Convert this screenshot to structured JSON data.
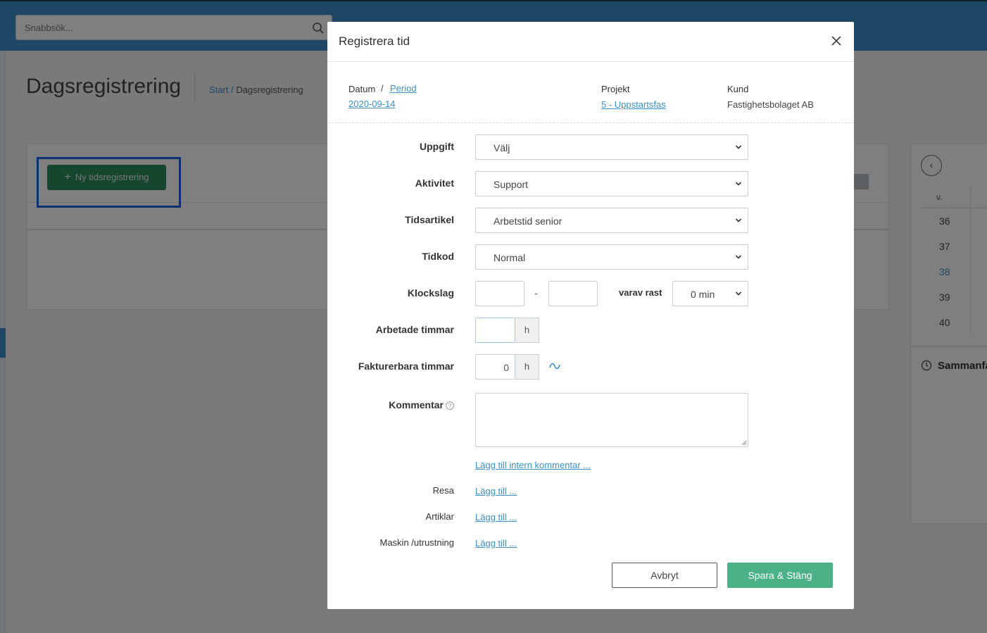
{
  "topbar": {
    "search_placeholder": "Snabbsök..."
  },
  "page": {
    "title": "Dagsregistrering",
    "breadcrumb": {
      "home": "Start /",
      "current": "Dagsregistrering"
    },
    "new_registration_label": "Ny tidsregistrering"
  },
  "calendar": {
    "week_header": "v.",
    "weeks": [
      {
        "number": "36",
        "current": false
      },
      {
        "number": "37",
        "current": false
      },
      {
        "number": "38",
        "current": true
      },
      {
        "number": "39",
        "current": false
      },
      {
        "number": "40",
        "current": false
      }
    ],
    "summary_label": "Sammanfa"
  },
  "modal": {
    "title": "Registrera tid",
    "meta": {
      "datum_label": "Datum",
      "separator": "/",
      "period_link": "Period",
      "date_value": "2020-09-14",
      "projekt_label": "Projekt",
      "projekt_value": "5 - Uppstartsfas",
      "kund_label": "Kund",
      "kund_value": "Fastighetsbolaget AB"
    },
    "fields": {
      "uppgift": {
        "label": "Uppgift",
        "value": "Välj"
      },
      "aktivitet": {
        "label": "Aktivitet",
        "value": "Support"
      },
      "tidsartikel": {
        "label": "Tidsartikel",
        "value": "Arbetstid senior"
      },
      "tidkod": {
        "label": "Tidkod",
        "value": "Normal"
      },
      "klockslag": {
        "label": "Klockslag",
        "from": "",
        "to": "",
        "dash": "-",
        "rast_label": "varav rast",
        "rast_value": "0 min"
      },
      "arbetade": {
        "label": "Arbetade timmar",
        "value": "",
        "unit": "h"
      },
      "fakturerbara": {
        "label": "Fakturerbara timmar",
        "value": "0",
        "unit": "h"
      },
      "kommentar": {
        "label": "Kommentar",
        "help": "?",
        "value": ""
      }
    },
    "links": {
      "intern_kommentar": "Lägg till intern kommentar ...",
      "resa_label": "Resa",
      "resa_link": "Lägg till ...",
      "artiklar_label": "Artiklar",
      "artiklar_link": "Lägg till ...",
      "maskin_label": "Maskin /utrustning",
      "maskin_link": "Lägg till ..."
    },
    "buttons": {
      "cancel": "Avbryt",
      "save": "Spara & Stäng"
    }
  },
  "colors": {
    "topbar": "#3b8fc8",
    "link": "#3b8fc8",
    "primary_green": "#4bb187",
    "new_button_green": "#2e8c5c",
    "highlight": "#1565e0"
  }
}
